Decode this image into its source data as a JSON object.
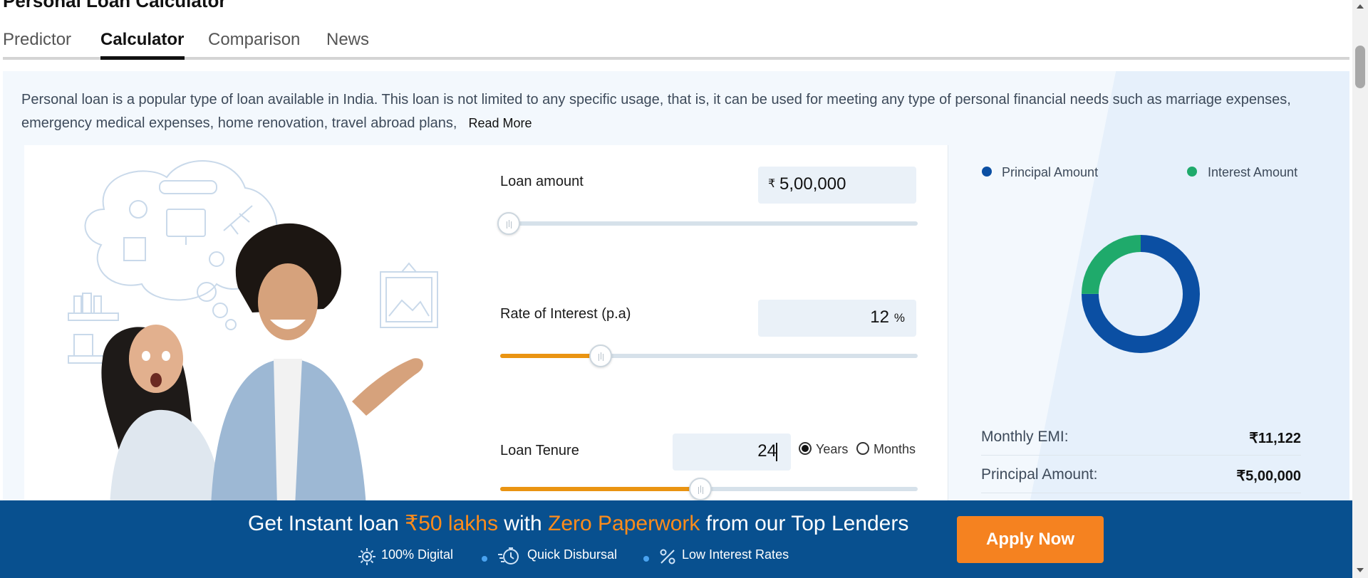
{
  "page": {
    "title": "Personal Loan Calculator"
  },
  "tabs": [
    {
      "label": "Predictor"
    },
    {
      "label": "Calculator",
      "active": true
    },
    {
      "label": "Comparison"
    },
    {
      "label": "News"
    }
  ],
  "description": {
    "text": "Personal loan is a popular type of loan available in India. This loan is not limited to any specific usage, that is, it can be used for meeting any type of personal financial needs such as marriage expenses, emergency medical expenses, home renovation, travel abroad plans,",
    "read_more": "Read More"
  },
  "calculator": {
    "loan_amount": {
      "label": "Loan amount",
      "currency_symbol": "₹",
      "value": "5,00,000",
      "slider_fraction": 0.02
    },
    "interest": {
      "label": "Rate of Interest (p.a)",
      "value": "12",
      "unit": "%",
      "slider_fraction": 0.24
    },
    "tenure": {
      "label": "Loan Tenure",
      "value": "24",
      "unit_options": [
        "Years",
        "Months"
      ],
      "selected_unit": "Years",
      "slider_fraction": 0.48
    }
  },
  "breakdown": {
    "legend": [
      {
        "label": "Principal Amount",
        "color": "#0b4fa3"
      },
      {
        "label": "Interest Amount",
        "color": "#1faa6b"
      }
    ],
    "donut": {
      "principal_fraction": 0.75,
      "interest_fraction": 0.25
    },
    "summary": [
      {
        "label": "Monthly EMI:",
        "value": "₹11,122"
      },
      {
        "label": "Principal Amount:",
        "value": "₹5,00,000"
      }
    ]
  },
  "promo": {
    "headline_parts": [
      "Get Instant loan ",
      "₹50 lakhs",
      " with ",
      "Zero Paperwork",
      " from our Top Lenders"
    ],
    "features": [
      {
        "label": "100% Digital",
        "icon": "gear-icon"
      },
      {
        "label": "Quick Disbursal",
        "icon": "timer-icon"
      },
      {
        "label": "Low Interest Rates",
        "icon": "percent-icon"
      }
    ],
    "cta": "Apply Now",
    "colors": {
      "background": "#08508f",
      "highlight": "#ff8c1a",
      "cta": "#f58220"
    }
  }
}
